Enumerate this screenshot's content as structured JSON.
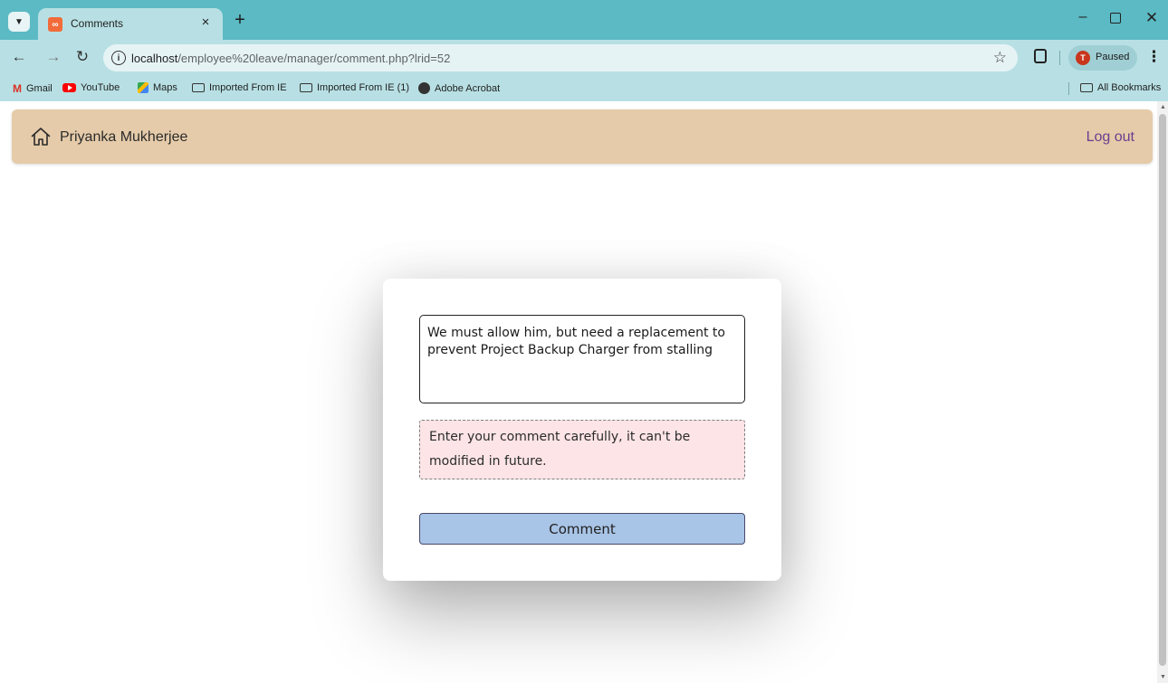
{
  "browser": {
    "tab_title": "Comments",
    "tab_close": "×",
    "new_tab": "+",
    "url_host": "localhost",
    "url_path": "/employee%20leave/manager/comment.php?lrid=52",
    "profile_initial": "T",
    "profile_status": "Paused",
    "bookmarks": [
      "Gmail",
      "YouTube",
      "Maps",
      "Imported From IE",
      "Imported From IE (1)",
      "Adobe Acrobat"
    ],
    "all_bookmarks": "All Bookmarks"
  },
  "navbar": {
    "user_name": "Priyanka Mukherjee",
    "logout_label": "Log out"
  },
  "form": {
    "comment_value": "We must allow him, but need a replacement to prevent Project Backup Charger from stalling",
    "warning_text": "Enter your comment carefully, it can't be modified in future.",
    "submit_label": "Comment"
  },
  "colors": {
    "tabstrip": "#5bbac3",
    "toolbar": "#b8e0e4",
    "navbar_bg": "#e5cba9",
    "logout_link": "#6b3d8f",
    "warning_bg": "#fde4e6",
    "button_bg": "#a8c4e6"
  }
}
